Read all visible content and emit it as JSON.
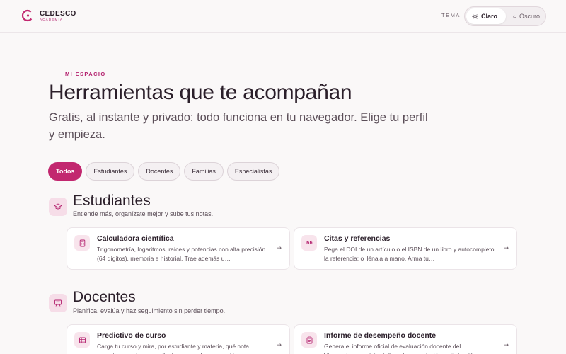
{
  "brand": {
    "name": "CEDESCO",
    "sub": "ACADEMIA",
    "accent": "#c2276f"
  },
  "theme": {
    "label": "TEMA",
    "light": "Claro",
    "dark": "Oscuro",
    "selected": "Claro"
  },
  "hero": {
    "eyebrow": "MI ESPACIO",
    "title": "Herramientas que te acompañan",
    "subtitle": "Gratis, al instante y privado: todo funciona en tu navegador. Elige tu perfil y empieza."
  },
  "filters": [
    "Todos",
    "Estudiantes",
    "Docentes",
    "Familias",
    "Especialistas"
  ],
  "sections": [
    {
      "title": "Estudiantes",
      "desc": "Entiende más, organízate mejor y sube tus notas.",
      "icon": "graduation-cap-icon",
      "cards": [
        {
          "title": "Calculadora científica",
          "desc": "Trigonometría, logaritmos, raíces y potencias con alta precisión (64 dígitos), memoria e historial. Trae además u…",
          "icon": "calculator-icon",
          "arrow": "→"
        },
        {
          "title": "Citas y referencias",
          "desc": "Pega el DOI de un artículo o el ISBN de un libro y autocompleto la referencia; o llénala a mano. Arma tu…",
          "icon": "quote-icon",
          "arrow": "→"
        }
      ]
    },
    {
      "title": "Docentes",
      "desc": "Planifica, evalúa y haz seguimiento sin perder tiempo.",
      "icon": "presentation-board-icon",
      "cards": [
        {
          "title": "Predictivo de curso",
          "desc": "Carga tu curso y mira, por estudiante y materia, qué nota necesitan en el examen final para aprobar — y quién ya…",
          "icon": "spreadsheet-icon",
          "arrow": "→"
        },
        {
          "title": "Informe de desempeño docente",
          "desc": "Genera el informe oficial de evaluación docente del Vicerrectorado: visita áulica, documentación, satisfacción…",
          "icon": "clipboard-icon",
          "arrow": "→"
        }
      ]
    }
  ]
}
